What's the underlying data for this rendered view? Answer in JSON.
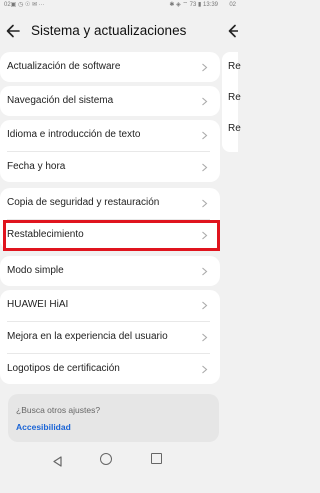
{
  "status": {
    "left": "02▣ ◷ ☉ ✉ ···",
    "right": "✱ ◈ ⌔ 73 ▮ 13:39",
    "right2": "02"
  },
  "header": {
    "title": "Sistema y actualizaciones"
  },
  "items": [
    {
      "label": "Actualización de software"
    },
    {
      "label": "Navegación del sistema"
    },
    {
      "label": "Idioma e introducción de texto"
    },
    {
      "label": "Fecha y hora"
    },
    {
      "label": "Copia de seguridad y restauración"
    },
    {
      "label": "Restablecimiento"
    },
    {
      "label": "Modo simple"
    },
    {
      "label": "HUAWEI HiAI"
    },
    {
      "label": "Mejora en la experiencia del usuario"
    },
    {
      "label": "Logotipos de certificación"
    }
  ],
  "right_panel": {
    "items": [
      "Re",
      "Re",
      "Re"
    ]
  },
  "search_card": {
    "question": "¿Busca otros ajustes?",
    "link": "Accesibilidad"
  },
  "colors": {
    "highlight": "#e0141e",
    "link": "#1a64d6"
  }
}
